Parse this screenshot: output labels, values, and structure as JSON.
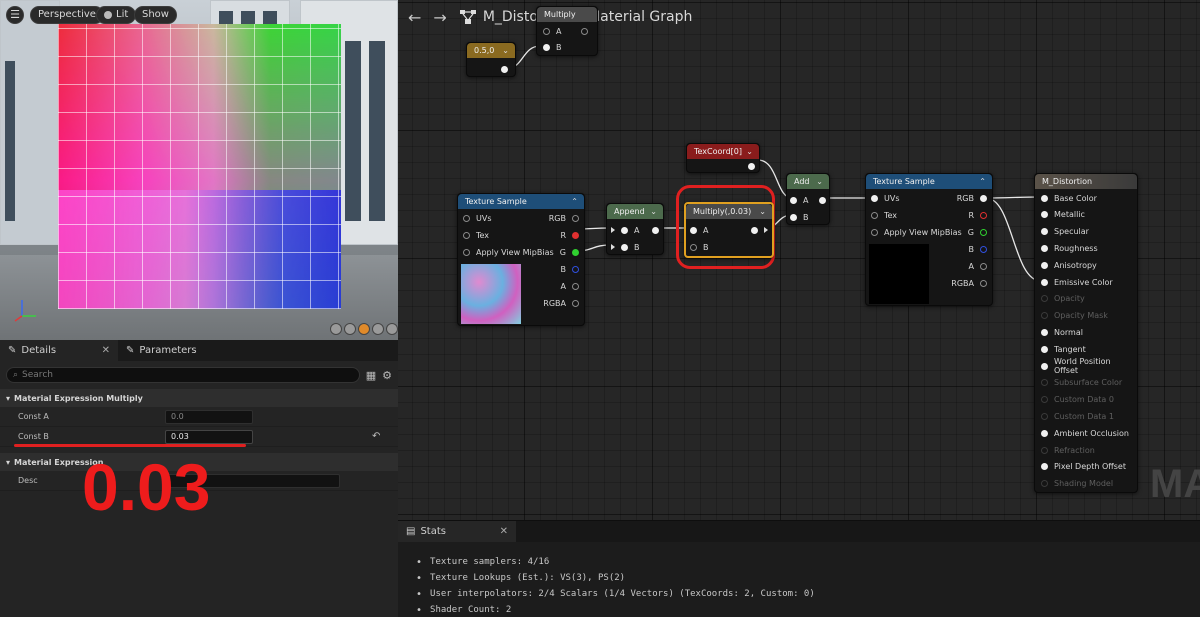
{
  "viewport": {
    "perspective_label": "Perspective",
    "lit_label": "Lit",
    "show_label": "Show"
  },
  "details": {
    "tabs": [
      {
        "label": "Details"
      },
      {
        "label": "Parameters"
      }
    ],
    "search_placeholder": "Search",
    "sections": {
      "multiply": "Material Expression Multiply",
      "expression": "Material Expression"
    },
    "props": {
      "const_a": {
        "label": "Const A",
        "value": "0.0"
      },
      "const_b": {
        "label": "Const B",
        "value": "0.03"
      },
      "desc": {
        "label": "Desc",
        "value": ""
      }
    },
    "annotation_value": "0.03"
  },
  "graph": {
    "breadcrumb": {
      "material": "M_Distortion",
      "graph": "Material Graph"
    },
    "watermark": "MA",
    "nodes": {
      "multiply_top": {
        "title": "Multiply",
        "pin_a": "A",
        "pin_b": "B"
      },
      "constant": {
        "title": "0.5,0"
      },
      "texture_sample_1": {
        "title": "Texture Sample",
        "inputs": [
          "UVs",
          "Tex",
          "Apply View MipBias"
        ],
        "outputs": [
          "RGB",
          "R",
          "G",
          "B",
          "A",
          "RGBA"
        ]
      },
      "append": {
        "title": "Append",
        "pin_a": "A",
        "pin_b": "B"
      },
      "texcoord": {
        "title": "TexCoord[0]"
      },
      "multiply_003": {
        "title": "Multiply(,0.03)",
        "pin_a": "A",
        "pin_b": "B"
      },
      "add": {
        "title": "Add",
        "pin_a": "A",
        "pin_b": "B"
      },
      "texture_sample_2": {
        "title": "Texture Sample",
        "inputs": [
          "UVs",
          "Tex",
          "Apply View MipBias"
        ],
        "outputs": [
          "RGB",
          "R",
          "G",
          "B",
          "A",
          "RGBA"
        ]
      },
      "material": {
        "title": "M_Distortion",
        "pins": [
          {
            "label": "Base Color",
            "active": true
          },
          {
            "label": "Metallic",
            "active": true
          },
          {
            "label": "Specular",
            "active": true
          },
          {
            "label": "Roughness",
            "active": true
          },
          {
            "label": "Anisotropy",
            "active": true
          },
          {
            "label": "Emissive Color",
            "active": true
          },
          {
            "label": "Opacity",
            "active": false
          },
          {
            "label": "Opacity Mask",
            "active": false
          },
          {
            "label": "Normal",
            "active": true
          },
          {
            "label": "Tangent",
            "active": true
          },
          {
            "label": "World Position Offset",
            "active": true
          },
          {
            "label": "Subsurface Color",
            "active": false
          },
          {
            "label": "Custom Data 0",
            "active": false
          },
          {
            "label": "Custom Data 1",
            "active": false
          },
          {
            "label": "Ambient Occlusion",
            "active": true
          },
          {
            "label": "Refraction",
            "active": false
          },
          {
            "label": "Pixel Depth Offset",
            "active": true
          },
          {
            "label": "Shading Model",
            "active": false
          }
        ]
      }
    },
    "colors": {
      "tex_header": "#1e4e78",
      "append_header": "#4c6a4c",
      "texcoord_header": "#8a1c1c",
      "constant_header": "#8a6a20",
      "material_header": "#4a4a4a",
      "highlight": "#e02020"
    }
  },
  "stats": {
    "tab_label": "Stats",
    "lines": [
      "Texture samplers: 4/16",
      "Texture Lookups (Est.): VS(3), PS(2)",
      "User interpolators: 2/4 Scalars (1/4 Vectors) (TexCoords: 2, Custom: 0)",
      "Shader Count: 2"
    ]
  }
}
